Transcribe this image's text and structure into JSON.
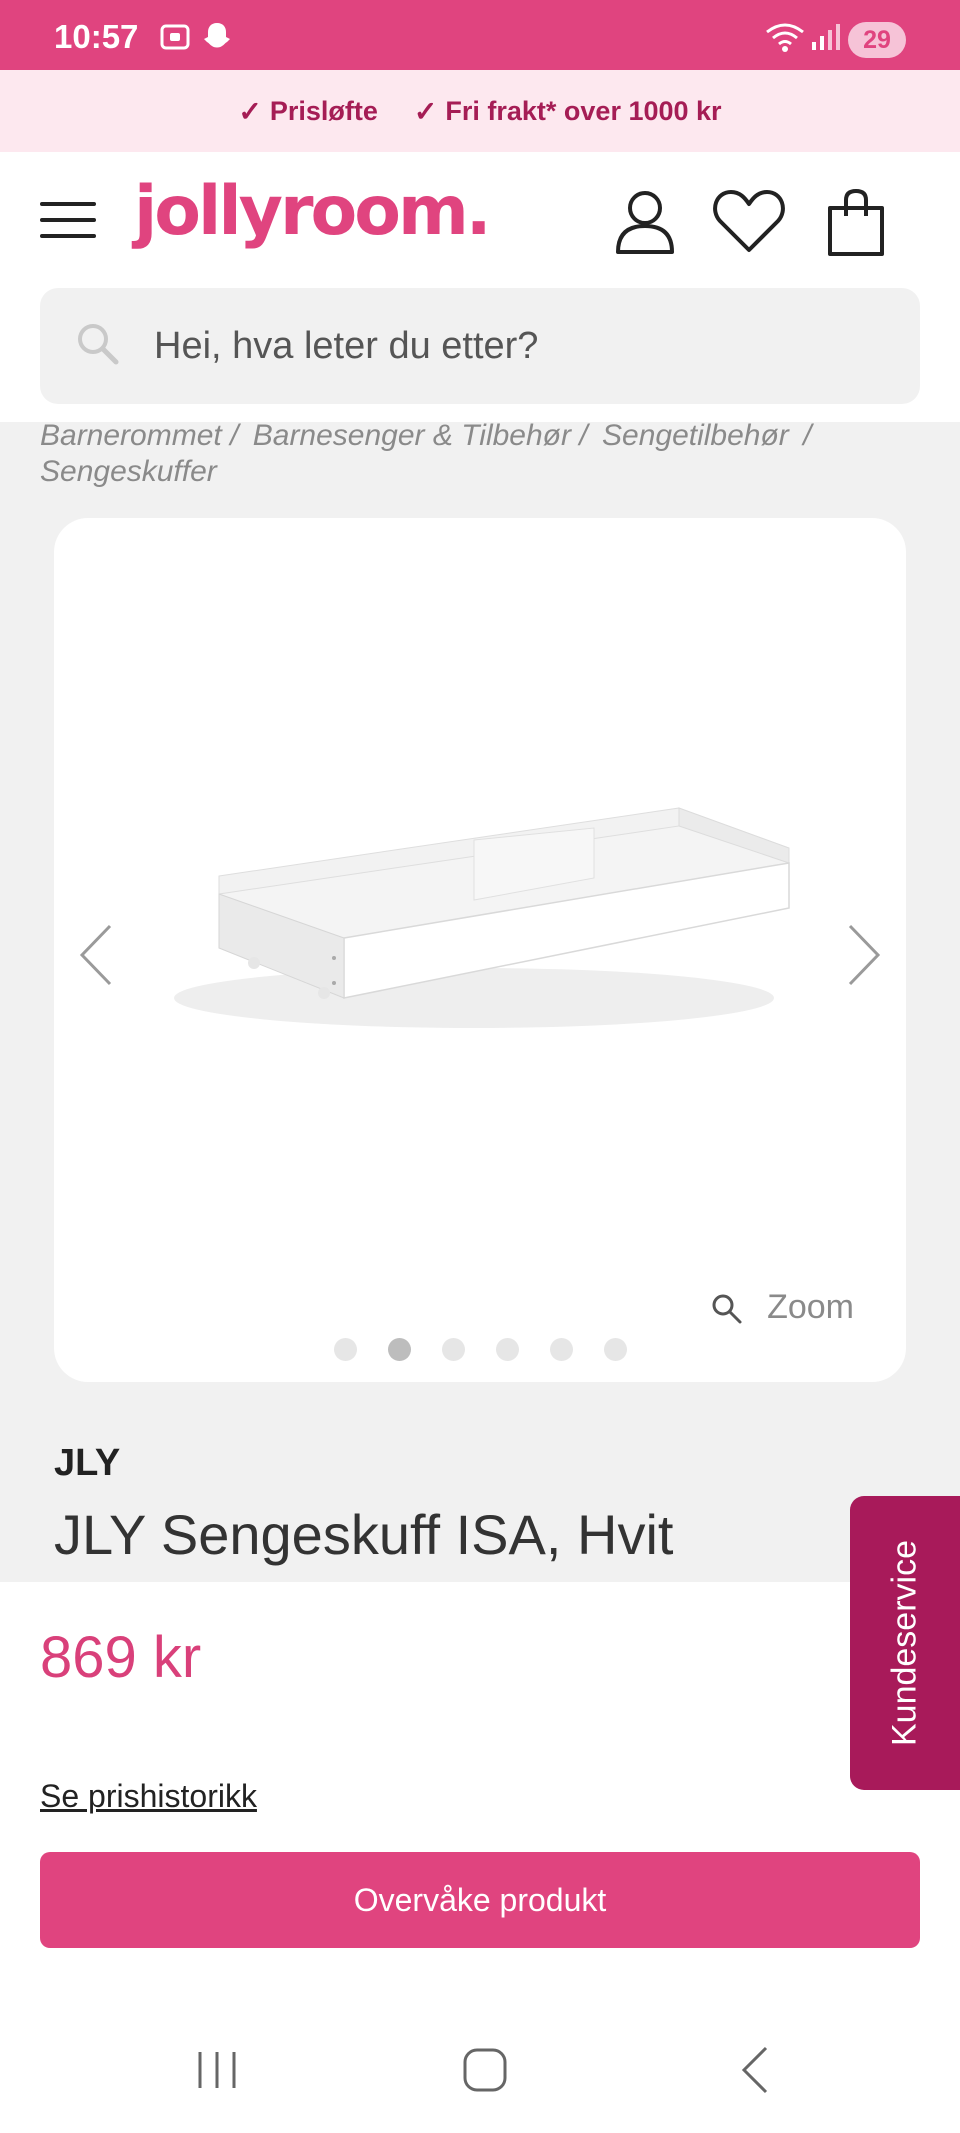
{
  "status_bar": {
    "time": "10:57",
    "battery": "29"
  },
  "promo": {
    "items": [
      "Prisløfte",
      "Fri frakt* over 1000 kr"
    ]
  },
  "header": {
    "logo": "jollyroom."
  },
  "search": {
    "placeholder": "Hei, hva leter du etter?"
  },
  "breadcrumb": [
    "Barnerommet /",
    "Barnesenger & Tilbehør /",
    "Sengetilbehør",
    "/",
    "Sengeskuffer"
  ],
  "gallery": {
    "zoom_label": "Zoom",
    "image_count": 6,
    "active_index": 2
  },
  "product": {
    "brand": "JLY",
    "title": "JLY Sengeskuff ISA, Hvit",
    "price": "869 kr",
    "price_history_link": "Se prishistorikk",
    "watch_button": "Overvåke produkt"
  },
  "customer_service": {
    "label": "Kundeservice"
  },
  "colors": {
    "brand_pink": "#e0447f",
    "service_plum": "#a81a5a",
    "promo_bg": "#fde8ef"
  }
}
